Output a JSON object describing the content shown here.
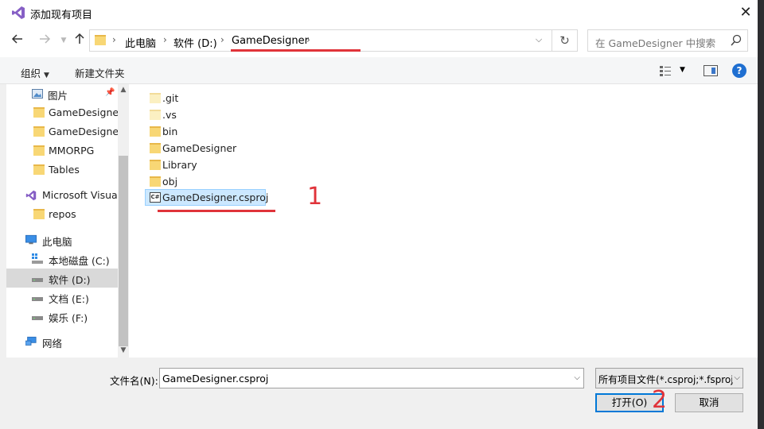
{
  "window": {
    "title": "添加现有项目",
    "close_glyph": "✕"
  },
  "address": {
    "crumbs": [
      "此电脑",
      "软件 (D:)",
      "GameDesigner"
    ],
    "search_placeholder": "在 GameDesigner 中搜索"
  },
  "toolbar": {
    "organize_label": "组织",
    "new_folder_label": "新建文件夹",
    "help_glyph": "?"
  },
  "nav": {
    "items": [
      {
        "label": "图片",
        "icon": "pictures-icon"
      },
      {
        "label": "GameDesigner",
        "icon": "folder-icon"
      },
      {
        "label": "GameDesigner",
        "icon": "folder-icon"
      },
      {
        "label": "MMORPG",
        "icon": "folder-icon"
      },
      {
        "label": "Tables",
        "icon": "folder-icon"
      },
      {
        "label": "Microsoft Visual",
        "icon": "visual-studio-icon"
      },
      {
        "label": "repos",
        "icon": "folder-icon"
      },
      {
        "label": "此电脑",
        "icon": "computer-icon"
      },
      {
        "label": "本地磁盘 (C:)",
        "icon": "system-drive-icon"
      },
      {
        "label": "软件 (D:)",
        "icon": "drive-icon",
        "selected": true
      },
      {
        "label": "文档 (E:)",
        "icon": "drive-icon"
      },
      {
        "label": "娱乐 (F:)",
        "icon": "drive-icon"
      },
      {
        "label": "网络",
        "icon": "network-icon"
      }
    ]
  },
  "files": [
    {
      "name": ".git",
      "icon": "folder-icon"
    },
    {
      "name": ".vs",
      "icon": "folder-icon"
    },
    {
      "name": "bin",
      "icon": "folder-icon"
    },
    {
      "name": "GameDesigner",
      "icon": "folder-icon"
    },
    {
      "name": "Library",
      "icon": "folder-icon"
    },
    {
      "name": "obj",
      "icon": "folder-icon"
    },
    {
      "name": "GameDesigner.csproj",
      "icon": "csproj-icon",
      "selected": true
    }
  ],
  "csproj_badge": "C#",
  "bottom": {
    "filename_label": "文件名(N):",
    "filename_value": "GameDesigner.csproj",
    "filter_value": "所有项目文件(*.csproj;*.fsproj",
    "open_label": "打开(O)",
    "cancel_label": "取消"
  },
  "annotations": {
    "marker_1": "1",
    "marker_2": "2",
    "color": "#e0333a"
  }
}
